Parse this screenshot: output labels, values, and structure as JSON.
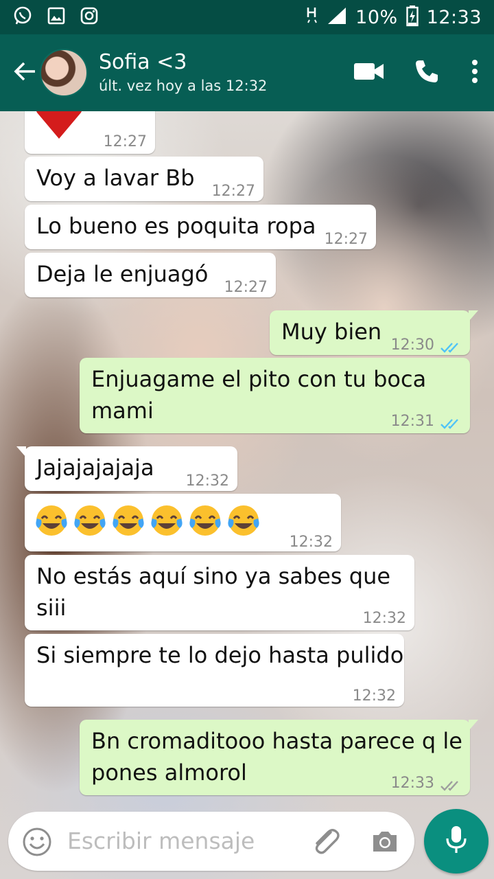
{
  "status_bar": {
    "battery": "10%",
    "time": "12:33",
    "icons": [
      "whatsapp-icon",
      "gallery-icon",
      "instagram-icon",
      "network-h-icon",
      "signal-icon",
      "battery-icon"
    ]
  },
  "header": {
    "contact_name": "Sofia <3",
    "last_seen": "últ. vez hoy a las 12:32",
    "icons": [
      "back-arrow-icon",
      "video-call-icon",
      "phone-icon",
      "more-vert-icon"
    ],
    "colors": {
      "app_bar": "#075e54",
      "status_bar": "#054d44"
    }
  },
  "messages": [
    {
      "dir": "in",
      "text": "",
      "emoji": [
        "heart"
      ],
      "time": "12:27"
    },
    {
      "dir": "in",
      "text": "Voy a lavar Bb",
      "time": "12:27"
    },
    {
      "dir": "in",
      "text": "Lo bueno es poquita ropa",
      "time": "12:27"
    },
    {
      "dir": "in",
      "text": "Deja le enjuagó",
      "time": "12:27"
    },
    {
      "dir": "out",
      "text": "Muy bien",
      "time": "12:30",
      "status": "read"
    },
    {
      "dir": "out",
      "text": "Enjuagame el pito con tu boca\nmami",
      "time": "12:31",
      "status": "read"
    },
    {
      "dir": "in",
      "text": "Jajajajajaja",
      "time": "12:32"
    },
    {
      "dir": "in",
      "text": "",
      "emoji": [
        "face-with-tears-of-joy",
        "face-with-tears-of-joy",
        "face-with-tears-of-joy",
        "face-with-tears-of-joy",
        "face-with-tears-of-joy",
        "face-with-tears-of-joy"
      ],
      "time": "12:32"
    },
    {
      "dir": "in",
      "text": "No estás aquí sino ya sabes que\nsiii",
      "time": "12:32"
    },
    {
      "dir": "in",
      "text": "Si siempre te lo dejo hasta pulido",
      "time": "12:32"
    },
    {
      "dir": "out",
      "text": "Bn cromaditooo hasta parece q le\npones almorol",
      "time": "12:33",
      "status": "delivered"
    }
  ],
  "input": {
    "placeholder": "Escribir mensaje",
    "icons": [
      "emoji-icon",
      "attach-icon",
      "camera-icon",
      "mic-icon"
    ]
  },
  "colors": {
    "incoming_bubble": "#ffffff",
    "outgoing_bubble": "#dcf8c6",
    "read_ticks": "#4fc3f7",
    "delivered_ticks": "#9e9e9e",
    "mic_button": "#0a8f7f"
  }
}
